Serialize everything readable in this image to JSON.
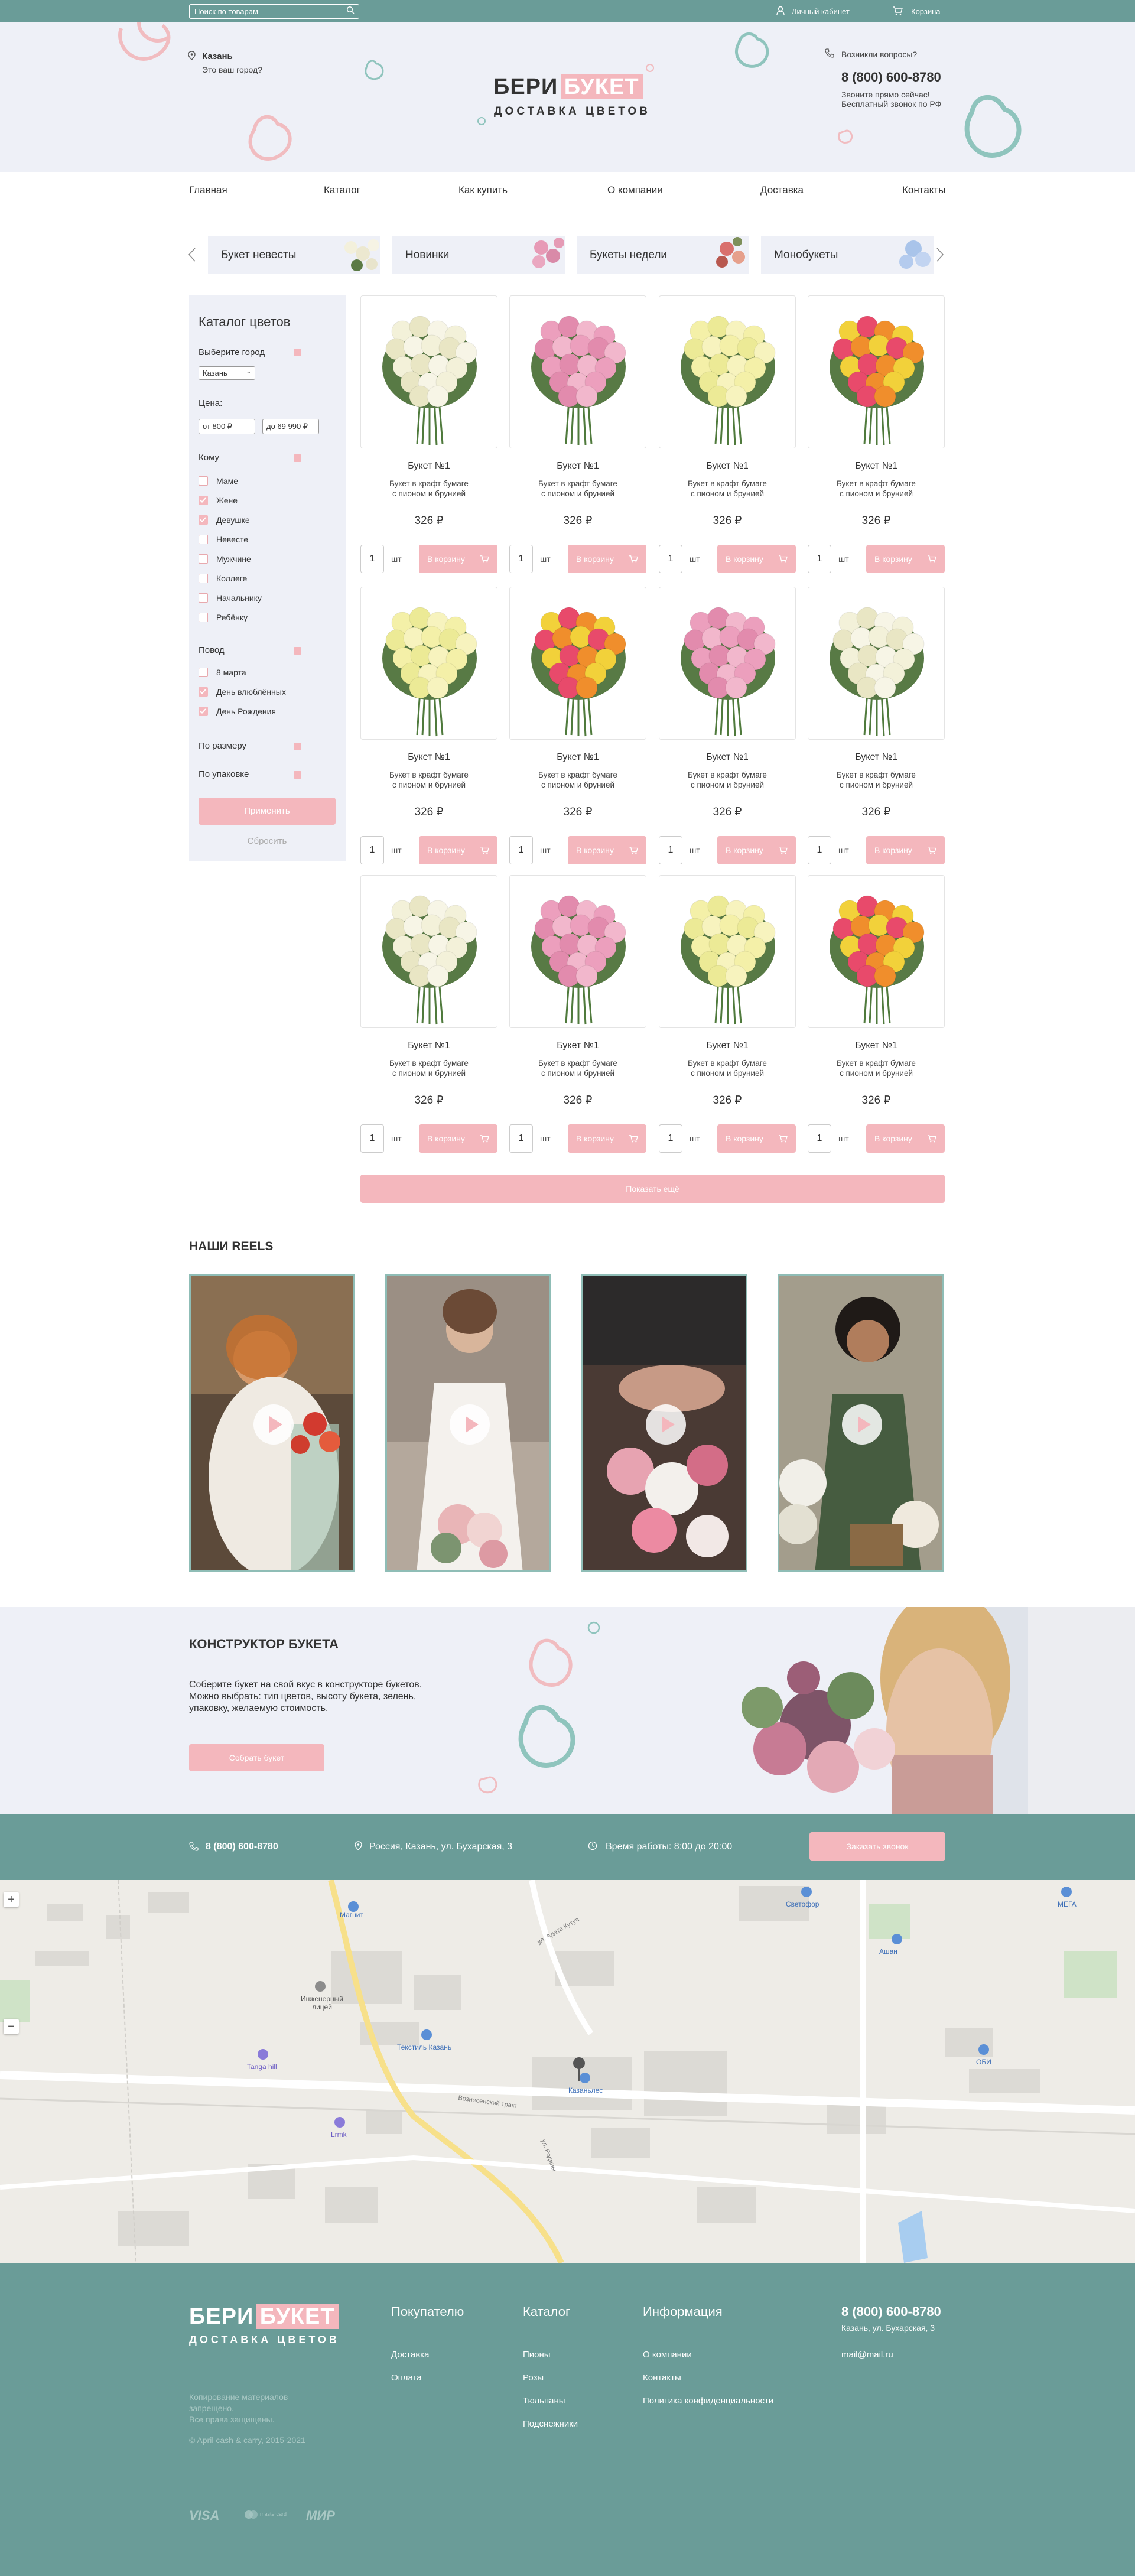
{
  "topbar": {
    "search_placeholder": "Поиск по товарам",
    "account": "Личный кабинет",
    "cart": "Корзина"
  },
  "header": {
    "city": "Казань",
    "city_question": "Это ваш город?",
    "logo_word1": "БЕРИ",
    "logo_word2": "БУКЕТ",
    "logo_sub": "ДОСТАВКА ЦВЕТОВ",
    "questions": "Возникли вопросы?",
    "phone": "8 (800) 600-8780",
    "call_note1": "Звоните прямо сейчас!",
    "call_note2": "Бесплатный звонок по РФ"
  },
  "nav": [
    "Главная",
    "Каталог",
    "Как купить",
    "О компании",
    "Доставка",
    "Контакты"
  ],
  "categories": [
    "Букет невесты",
    "Новинки",
    "Букеты недели",
    "Монобукеты"
  ],
  "sidebar": {
    "title": "Каталог цветов",
    "city_label": "Выберите город",
    "city_value": "Казань",
    "price_label": "Цена:",
    "price_from": "от 800 ₽",
    "price_to": "до 69 990 ₽",
    "whom_label": "Кому",
    "whom": [
      {
        "label": "Маме",
        "checked": false
      },
      {
        "label": "Жене",
        "checked": true
      },
      {
        "label": "Девушке",
        "checked": true
      },
      {
        "label": "Невесте",
        "checked": false
      },
      {
        "label": "Мужчине",
        "checked": false
      },
      {
        "label": "Коллеге",
        "checked": false
      },
      {
        "label": "Начальнику",
        "checked": false
      },
      {
        "label": "Ребёнку",
        "checked": false
      }
    ],
    "occasion_label": "Повод",
    "occasion": [
      {
        "label": "8 марта",
        "checked": false
      },
      {
        "label": "День влюблённых",
        "checked": true
      },
      {
        "label": "День Рождения",
        "checked": true
      }
    ],
    "size_label": "По размеру",
    "pack_label": "По упаковке",
    "apply": "Применить",
    "reset": "Сбросить"
  },
  "product": {
    "name": "Букет №1",
    "desc1": "Букет в крафт бумаге",
    "desc2": "с пионом и брунией",
    "price": "326 ₽",
    "qty": "1",
    "unit": "шт",
    "cart": "В корзину"
  },
  "show_more": "Показать ещё",
  "reels_title": "НАШИ REELS",
  "constructor": {
    "title": "КОНСТРУКТОР БУКЕТА",
    "text1": "Соберите букет на свой вкус в конструкторе букетов.",
    "text2": "Можно выбрать: тип цветов, высоту букета, зелень,",
    "text3": "упаковку, желаемую стоимость.",
    "button": "Собрать букет"
  },
  "info": {
    "phone": "8 (800) 600-8780",
    "address": "Россия, Казань, ул. Бухарская, 3",
    "hours": "Время работы: 8:00 до 20:00",
    "callback": "Заказать звонок"
  },
  "map": {
    "labels": [
      "Магнит",
      "Светофор",
      "МЕГА",
      "Ашан",
      "Инженерный лицей",
      "Текстиль Казань",
      "Tanga hill",
      "Казаньлес",
      "Lrmk",
      "ОБИ",
      "ул. Адата Кутуя",
      "ул. Родины",
      "Вознесенский тракт"
    ],
    "zoom_in": "+",
    "zoom_out": "−"
  },
  "footer": {
    "logo_word1": "БЕРИ",
    "logo_word2": "БУКЕТ",
    "logo_sub": "ДОСТАВКА ЦВЕТОВ",
    "copy1": "Копирование материалов",
    "copy2": "запрещено.",
    "copy3": "Все права защищены.",
    "copy4": "© April cash & carry, 2015-2021",
    "buyer_title": "Покупателю",
    "buyer": [
      "Доставка",
      "Оплата"
    ],
    "catalog_title": "Каталог",
    "catalog": [
      "Пионы",
      "Розы",
      "Тюльпаны",
      "Подснежники"
    ],
    "info_title": "Информация",
    "info": [
      "О компании",
      "Контакты",
      "Политика конфиденциальности"
    ],
    "phone": "8 (800) 600-8780",
    "address": "Казань, ул. Бухарская, 3",
    "email": "mail@mail.ru",
    "pay": [
      "VISA",
      "mastercard",
      "МИР"
    ]
  },
  "colors": {
    "teal": "#6a9c98",
    "pink": "#f4b7bd",
    "bg": "#eef0f7"
  }
}
